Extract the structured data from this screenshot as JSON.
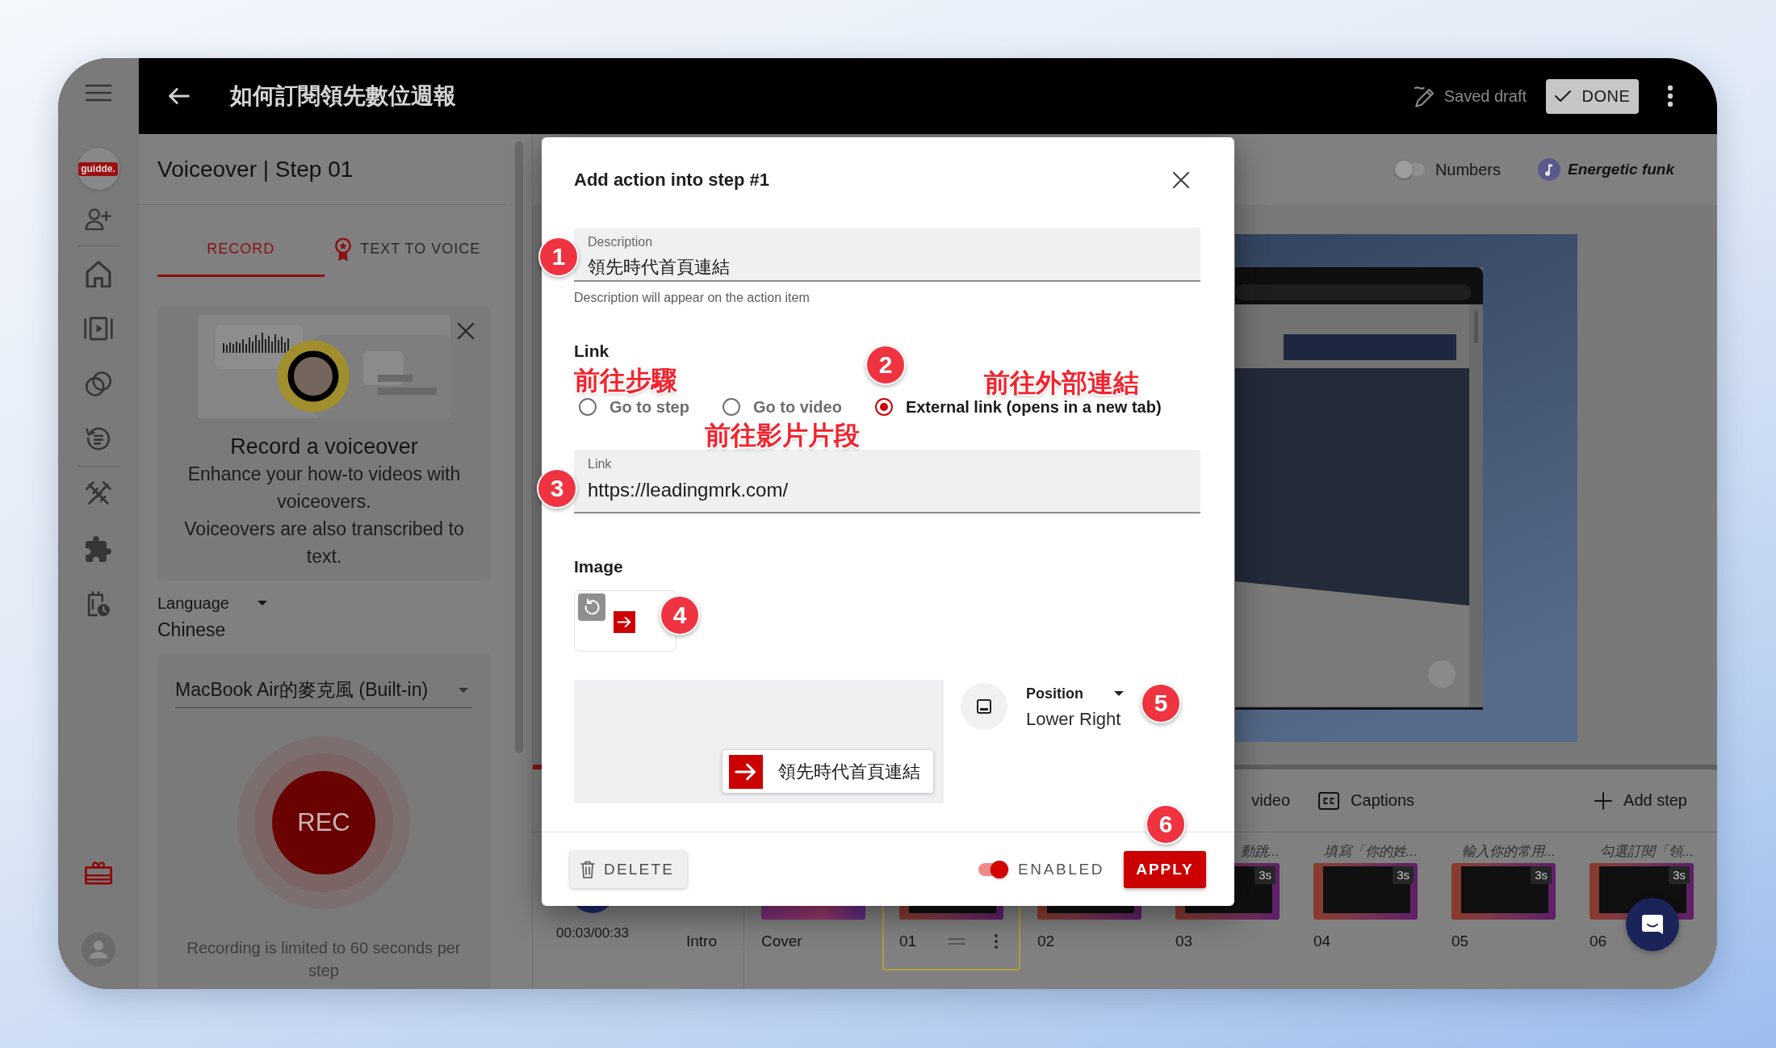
{
  "top_bar": {
    "title": "如何訂閱領先數位週報",
    "status": "Saved draft",
    "done": "DONE"
  },
  "rail": {
    "logo": "guidde."
  },
  "panel": {
    "title": "Voiceover | Step 01",
    "tabs": [
      {
        "label": "RECORD",
        "selected": true
      },
      {
        "label": "TEXT TO VOICE",
        "selected": false
      }
    ],
    "promo": {
      "title": "Record a voiceover",
      "paragraphs": [
        "Enhance your how-to videos with voiceovers.",
        "Voiceovers are also transcribed to text."
      ]
    },
    "language": {
      "label": "Language",
      "value": "Chinese"
    },
    "microphone": {
      "value": "MacBook Air的麥克風 (Built-in)"
    },
    "record_button": "REC",
    "note": "Recording is limited to 60 seconds per step"
  },
  "toolbar": {
    "numbers": {
      "label": "Numbers",
      "on": false
    },
    "music": "Energetic funk"
  },
  "timeline": {
    "level": 0.09,
    "time": "00:03/00:33",
    "actions": [
      {
        "kind": "plain",
        "label": "video"
      },
      {
        "kind": "captions",
        "label": "Captions"
      }
    ],
    "add_step": "Add step",
    "intro": "Intro",
    "steps": [
      {
        "kind": "cover",
        "label": "Cover",
        "selected": false
      },
      {
        "kind": "step",
        "label": "01",
        "selected": true
      },
      {
        "kind": "step",
        "label": "02",
        "selected": false
      },
      {
        "kind": "step",
        "label": "03",
        "caption": "動跳...",
        "duration": "3s",
        "selected": false
      },
      {
        "kind": "step",
        "label": "04",
        "caption": "填寫「你的姓...",
        "duration": "3s",
        "selected": false
      },
      {
        "kind": "step",
        "label": "05",
        "caption": "輸入你的常用...",
        "duration": "3s",
        "selected": false
      },
      {
        "kind": "step",
        "label": "06",
        "caption": "勾選訂閱「領...",
        "duration": "3s",
        "selected": false
      }
    ]
  },
  "dialog": {
    "title": "Add action into step #1",
    "description": {
      "label": "Description",
      "value": "領先時代首頁連結",
      "helper": "Description will appear on the action item"
    },
    "link_heading": "Link",
    "link_options": [
      {
        "label": "Go to step",
        "selected": false
      },
      {
        "label": "Go to video",
        "selected": false
      },
      {
        "label": "External link (opens in a new tab)",
        "selected": true
      }
    ],
    "link": {
      "label": "Link",
      "value": "https://leadingmrk.com/"
    },
    "image_heading": "Image",
    "preview_chip": "領先時代首頁連結",
    "position": {
      "label": "Position",
      "value": "Lower Right"
    },
    "enabled": {
      "label": "ENABLED",
      "on": true
    },
    "delete": "DELETE",
    "apply": "APPLY"
  },
  "annotations": {
    "badges": [
      "1",
      "2",
      "3",
      "4",
      "5",
      "6"
    ],
    "labels": [
      "前往步驟",
      "前往影片片段",
      "前往外部連結"
    ]
  }
}
